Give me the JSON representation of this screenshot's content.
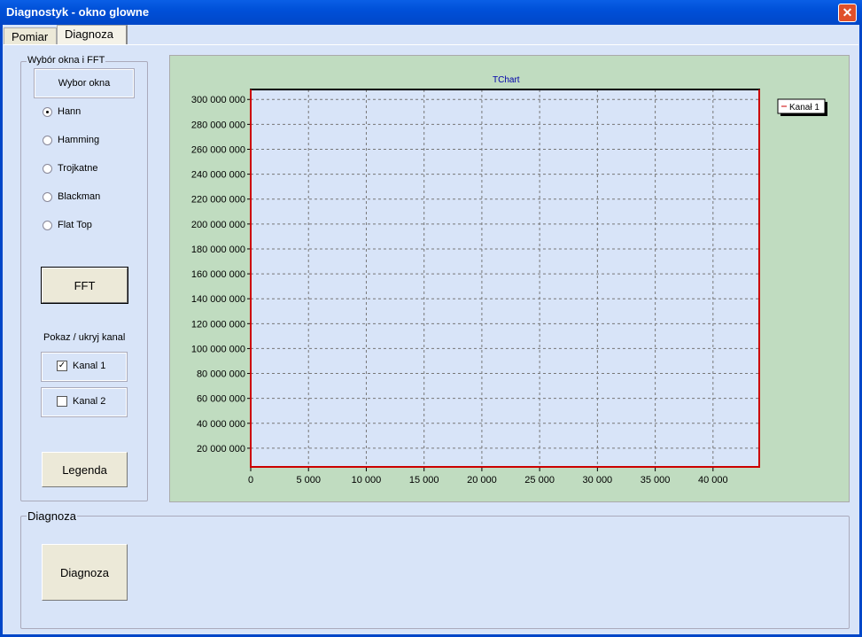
{
  "window": {
    "title": "Diagnostyk - okno glowne",
    "close": "✕"
  },
  "tabs": [
    {
      "label": "Pomiar"
    },
    {
      "label": "Diagnoza"
    }
  ],
  "fft_group": {
    "title": "Wybór okna i FFT",
    "window_label": "Wybor okna",
    "options": [
      {
        "label": "Hann",
        "selected": true
      },
      {
        "label": "Hamming"
      },
      {
        "label": "Trojkatne"
      },
      {
        "label": "Blackman"
      },
      {
        "label": "Flat Top"
      }
    ],
    "fft_button": "FFT",
    "show_hide_label": "Pokaz / ukryj kanal",
    "channels": [
      {
        "label": "Kanal 1",
        "checked": true,
        "mark": "✓"
      },
      {
        "label": "Kanal 2",
        "checked": false,
        "mark": ""
      }
    ],
    "legend_button": "Legenda"
  },
  "diag_group": {
    "title": "Diagnoza",
    "button": "Diagnoza"
  },
  "chart_data": {
    "type": "line",
    "title": "TChart",
    "xlabel": "",
    "ylabel": "",
    "xlim": [
      0,
      44000
    ],
    "ylim": [
      5000000,
      308000000
    ],
    "xticks": [
      0,
      5000,
      10000,
      15000,
      20000,
      25000,
      30000,
      35000,
      40000
    ],
    "xtick_labels": [
      "0",
      "5 000",
      "10 000",
      "15 000",
      "20 000",
      "25 000",
      "30 000",
      "35 000",
      "40 000"
    ],
    "yticks": [
      20000000,
      40000000,
      60000000,
      80000000,
      100000000,
      120000000,
      140000000,
      160000000,
      180000000,
      200000000,
      220000000,
      240000000,
      260000000,
      280000000,
      300000000
    ],
    "ytick_labels": [
      "20 000 000",
      "40 000 000",
      "60 000 000",
      "80 000 000",
      "100 000 000",
      "120 000 000",
      "140 000 000",
      "160 000 000",
      "180 000 000",
      "200 000 000",
      "220 000 000",
      "240 000 000",
      "260 000 000",
      "280 000 000",
      "300 000 000"
    ],
    "grid": true,
    "legend_placement": "top-right",
    "series": [
      {
        "name": "Kanał 1",
        "color": "#cc0000",
        "x": [
          0,
          0,
          44000,
          44000
        ],
        "y": [
          308000000,
          5000000,
          5000000,
          308000000
        ]
      }
    ]
  }
}
